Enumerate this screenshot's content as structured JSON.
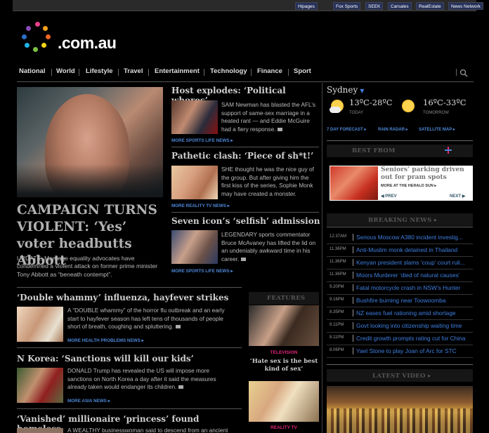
{
  "topbar": {
    "links": [
      "Hipages",
      "Fox Sports",
      "SEEK",
      "Carsales",
      "RealEstate",
      "News Network"
    ]
  },
  "logo": {
    "text": ".com.au"
  },
  "nav": {
    "items": [
      "National",
      "World",
      "Lifestyle",
      "Travel",
      "Entertainment",
      "Technology",
      "Finance",
      "Sport"
    ],
    "search_icon": "search-icon"
  },
  "lead": {
    "title": "CAMPAIGN TURNS VIOLENT: ‘Yes’ voter headbutts Abbott",
    "summary": "UPDATE: Marriage equality advocates have condemned a violent attack on former prime minister Tony Abbott as “beneath contempt”."
  },
  "stories_mid": [
    {
      "title": "Host explodes: ‘Political whores’",
      "summary": "SAM Newman has blasted the AFL’s support of same-sex marriage in a heated rant — and Eddie McGuire had a fiery response.",
      "more": "MORE SPORTS LIFE NEWS ▸"
    },
    {
      "title": "Pathetic clash: ‘Piece of sh*t!’",
      "summary": "SHE thought he was the nice guy of the group. But after giving him the first kiss of the series, Sophie Monk may have created a monster.",
      "more": "MORE REALITY TV NEWS ▸"
    },
    {
      "title": "Seven icon’s ‘selfish’ admission",
      "summary": "LEGENDARY sports commentator Bruce McAvaney has lifted the lid on an undeniably awkward time in his career.",
      "more": "MORE SPORTS LIFE NEWS ▸"
    }
  ],
  "stories_lower": [
    {
      "title": "‘Double whammy’ influenza, hayfever strikes",
      "summary": "A “DOUBLE whammy” of the horror flu outbreak and an early start to hayfever season has left tens of thousands of people short of breath, coughing and spluttering.",
      "more": "MORE HEALTH PROBLEMS NEWS ▸"
    },
    {
      "title": "N Korea: ‘Sanctions will kill our kids’",
      "summary": "DONALD Trump has revealed the US will impose more sanctions on North Korea a day after it said the measures already taken would endanger its children.",
      "more": "MORE ASIA NEWS ▸"
    },
    {
      "title": "‘Vanished’ millionaire ‘princess’ found homeless",
      "summary": "A WEALTHY businesswoman said to descend from an ancient"
    }
  ],
  "features": {
    "heading": "FEATURES",
    "items": [
      {
        "category": "TELEVISION",
        "title": "‘Hate sex is the best kind of sex’"
      },
      {
        "category": "REALITY TV",
        "title": ""
      }
    ]
  },
  "weather": {
    "city": "Sydney",
    "today_temp": "13ºC-28ºC",
    "today_label": "TODAY",
    "tomorrow_temp": "16ºC-33ºC",
    "tomorrow_label": "TOMORROW",
    "links": [
      "7 DAY FORECAST ▸",
      "RAIN RADAR ▸",
      "SATELLITE MAP ▸"
    ]
  },
  "best_from": {
    "heading": "BEST FROM",
    "title": "Seniors’ parking driven out for pram spots",
    "more": "MORE AT THE HERALD SUN ▸",
    "prev": "PREV",
    "next": "NEXT"
  },
  "breaking": {
    "heading": "BREAKING NEWS ▸",
    "items": [
      {
        "time": "12.37AM",
        "text": "Serious Moscow A380 incident investig..."
      },
      {
        "time": "11.36PM",
        "text": "Anti-Muslim monk detained in Thailand"
      },
      {
        "time": "11.36PM",
        "text": "Kenyan president slams ‘coup’ court ruli..."
      },
      {
        "time": "11.36PM",
        "text": "Moors Murderer ‘died of natural causes’"
      },
      {
        "time": "9.20PM",
        "text": "Fatal motorcycle crash in NSW’s Hunter"
      },
      {
        "time": "9.16PM",
        "text": "Bushfire burning near Toowoomba"
      },
      {
        "time": "8.35PM",
        "text": "NZ eases fuel rationing amid shortage"
      },
      {
        "time": "8.11PM",
        "text": "Govt looking into citizenship waiting time"
      },
      {
        "time": "8.11PM",
        "text": "Credit growth prompts rating cut for China"
      },
      {
        "time": "8.06PM",
        "text": "Yael Stone to play Joan of Arc for STC"
      }
    ]
  },
  "latest_video": {
    "heading": "LATEST VIDEO ▸"
  }
}
